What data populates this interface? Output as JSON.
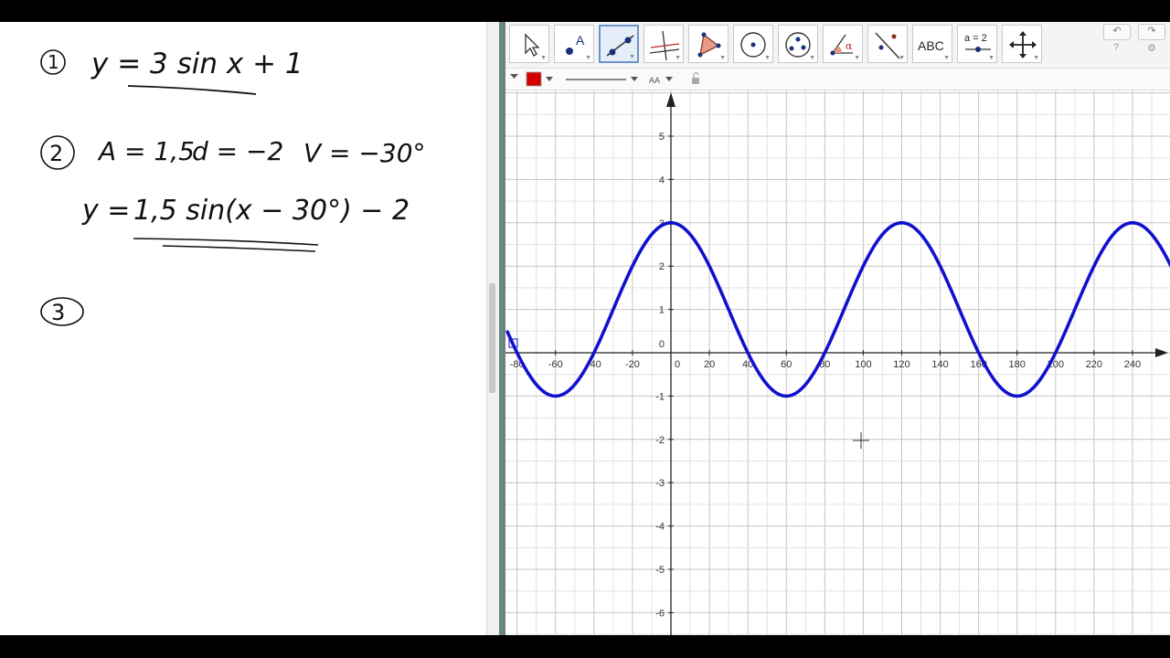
{
  "notes": {
    "line1": {
      "number": "1",
      "equation": "y = 3 sin x + 1"
    },
    "line2": {
      "number": "2",
      "amplitude": "A = 1,5",
      "offset": "d = −2",
      "shift": "V = −30°",
      "equation_lhs": "y =",
      "equation_rhs": "1,5 sin(x − 30°) − 2"
    },
    "line3": {
      "number": "3"
    }
  },
  "toolbar": {
    "tools": [
      {
        "name": "move-tool-icon"
      },
      {
        "name": "point-tool-icon",
        "label": "A"
      },
      {
        "name": "line-tool-icon",
        "selected": true
      },
      {
        "name": "perpendicular-line-tool-icon"
      },
      {
        "name": "polygon-tool-icon"
      },
      {
        "name": "circle-tool-icon"
      },
      {
        "name": "ellipse-tool-icon"
      },
      {
        "name": "angle-tool-icon",
        "label": "α"
      },
      {
        "name": "reflect-tool-icon"
      },
      {
        "name": "text-tool-icon",
        "label": "ABC"
      },
      {
        "name": "slider-tool-icon",
        "label": "a = 2"
      },
      {
        "name": "move-graphics-view-icon"
      }
    ],
    "undo": "↶",
    "redo": "↷",
    "help": "?",
    "settings": "⚙"
  },
  "stylebar": {
    "color": "#d40000",
    "font_label": "AA"
  },
  "chart_data": {
    "type": "line",
    "series": [
      {
        "x_start": -85,
        "x_end": 250,
        "function": "y = 2*cos(3x°) + 1",
        "color": "#1010d0"
      }
    ],
    "xlim": [
      -84,
      258
    ],
    "ylim": [
      -6.5,
      6
    ],
    "x_ticks": [
      "-80",
      "-60",
      "-40",
      "-20",
      "0",
      "20",
      "40",
      "60",
      "80",
      "100",
      "120",
      "140",
      "160",
      "180",
      "200",
      "220",
      "240"
    ],
    "y_ticks": [
      "-6",
      "-5",
      "-4",
      "-3",
      "-2",
      "-1",
      "0",
      "1",
      "2",
      "3",
      "4",
      "5"
    ],
    "grid": true
  }
}
